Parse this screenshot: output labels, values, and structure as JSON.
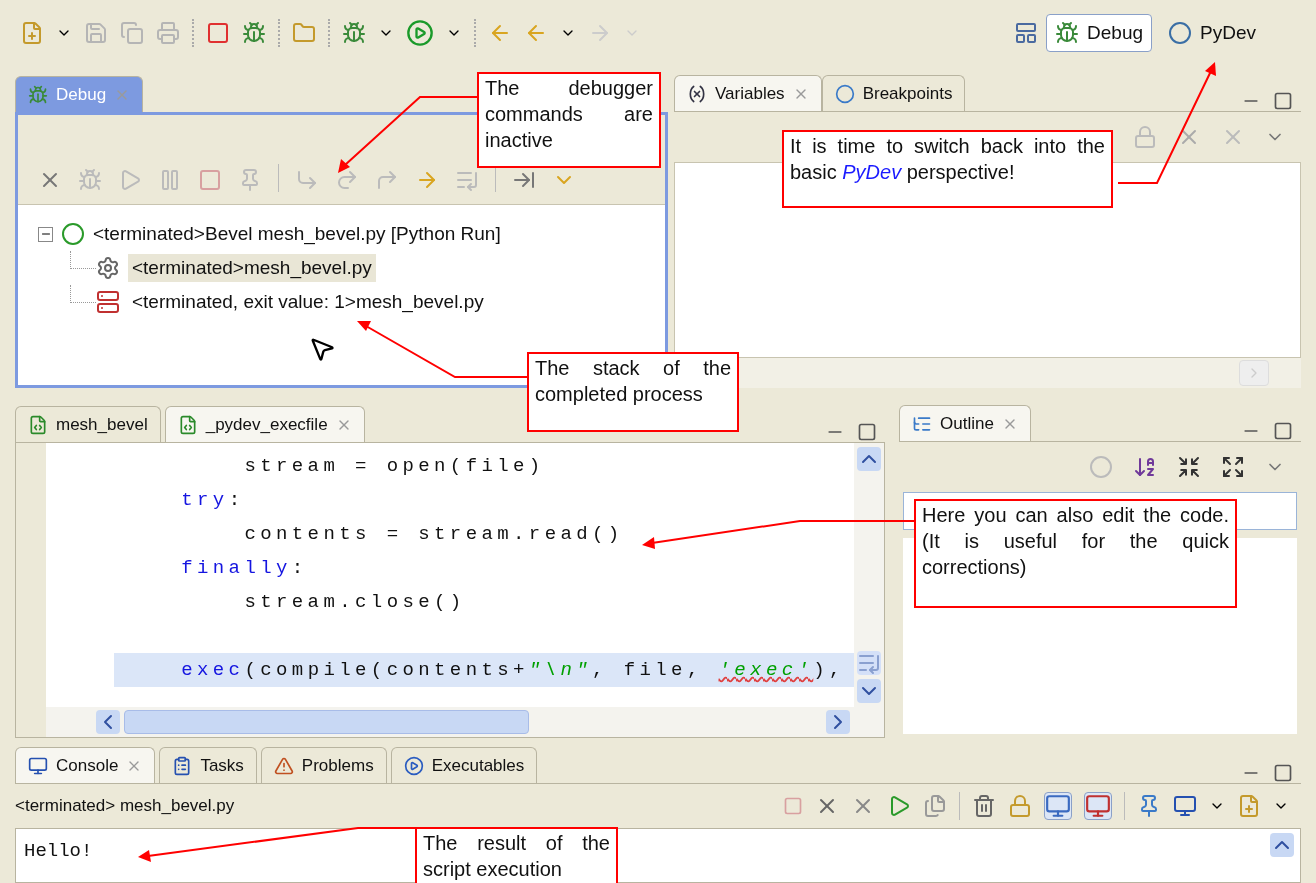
{
  "perspectives": [
    {
      "label": "Debug",
      "selected": true
    },
    {
      "label": "PyDev",
      "selected": false
    }
  ],
  "debug_view": {
    "tab": "Debug",
    "focused": true,
    "tree": [
      {
        "label": "<terminated>Bevel mesh_bevel.py [Python Run]",
        "expanded": true,
        "children": [
          {
            "label": "<terminated>mesh_bevel.py",
            "kind": "process",
            "selected": true
          },
          {
            "label": "<terminated, exit value: 1>mesh_bevel.py",
            "kind": "stack",
            "selected": false
          }
        ]
      }
    ]
  },
  "variables_view": {
    "tabs": [
      {
        "label": "Variables",
        "kind": "variables",
        "selected": true
      },
      {
        "label": "Breakpoints",
        "kind": "breakpoints",
        "selected": false
      }
    ]
  },
  "editor": {
    "tabs": [
      {
        "label": "mesh_bevel",
        "selected": false
      },
      {
        "label": "_pydev_execfile",
        "selected": true
      }
    ],
    "lines": [
      {
        "kind": "code",
        "tokens": [
          {
            "text": "        stream = open(file)",
            "kind": "plain"
          }
        ]
      },
      {
        "kind": "code",
        "tokens": [
          {
            "text": "    try",
            "kind": "keyword"
          },
          {
            "text": ":",
            "kind": "plain"
          }
        ]
      },
      {
        "kind": "code",
        "tokens": [
          {
            "text": "        contents = stream.read()",
            "kind": "plain"
          }
        ]
      },
      {
        "kind": "code",
        "tokens": [
          {
            "text": "    finally",
            "kind": "keyword"
          },
          {
            "text": ":",
            "kind": "plain"
          }
        ]
      },
      {
        "kind": "code",
        "tokens": [
          {
            "text": "        stream.close()",
            "kind": "plain"
          }
        ]
      },
      {
        "kind": "blank"
      },
      {
        "kind": "code",
        "current": true,
        "tokens": [
          {
            "text": "    exec",
            "kind": "keyword"
          },
          {
            "text": "(compile(contents+",
            "kind": "plain"
          },
          {
            "text": "\"\\n\"",
            "kind": "string"
          },
          {
            "text": ", file, ",
            "kind": "plain"
          },
          {
            "text": "'exec'",
            "kind": "string_error"
          },
          {
            "text": "),",
            "kind": "plain"
          }
        ]
      }
    ]
  },
  "outline_view": {
    "tab": "Outline"
  },
  "console_view": {
    "tabs": [
      {
        "label": "Console",
        "kind": "console",
        "selected": true
      },
      {
        "label": "Tasks",
        "kind": "tasks",
        "selected": false
      },
      {
        "label": "Problems",
        "kind": "problems",
        "selected": false
      },
      {
        "label": "Executables",
        "kind": "executables",
        "selected": false
      }
    ],
    "process": "<terminated> mesh_bevel.py",
    "output": "Hello!"
  },
  "annotations": [
    {
      "text": "The debugger commands are inactive"
    },
    {
      "text": "The stack of the completed process"
    },
    {
      "text": "It is time to switch back into the basic *PyDev* perspective!"
    },
    {
      "text": "Here you can also edit the code. (It is useful for the quick corrections)"
    },
    {
      "text": "The result of the script execution"
    }
  ]
}
